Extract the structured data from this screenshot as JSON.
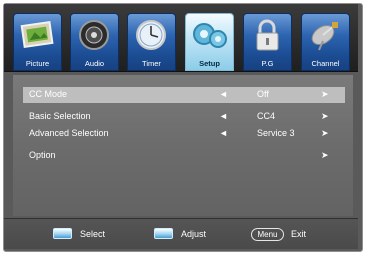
{
  "tabs": [
    {
      "label": "Picture",
      "icon": "picture-frame-icon",
      "active": false
    },
    {
      "label": "Audio",
      "icon": "speaker-icon",
      "active": false
    },
    {
      "label": "Timer",
      "icon": "clock-icon",
      "active": false
    },
    {
      "label": "Setup",
      "icon": "gears-icon",
      "active": true
    },
    {
      "label": "P.G",
      "icon": "padlock-icon",
      "active": false
    },
    {
      "label": "Channel",
      "icon": "satellite-dish-icon",
      "active": false
    }
  ],
  "menu": [
    {
      "label": "CC  Mode",
      "value": "Off",
      "left_arrow": "◄",
      "right_arrow": "➤",
      "selected": true
    },
    {
      "label": "Basic Selection",
      "value": "CC4",
      "left_arrow": "◄",
      "right_arrow": "➤",
      "selected": false
    },
    {
      "label": "Advanced Selection",
      "value": "Service 3",
      "left_arrow": "◄",
      "right_arrow": "➤",
      "selected": false
    },
    {
      "label": "Option",
      "value": "",
      "left_arrow": "",
      "right_arrow": "➤",
      "selected": false
    }
  ],
  "footer": {
    "select_label": "Select",
    "adjust_label": "Adjust",
    "menu_key": "Menu",
    "exit_label": "Exit"
  },
  "colors": {
    "tab_blue": "#2d64b0",
    "tab_active": "#bfe4f6",
    "panel": "#6c6c6c",
    "highlight": "#bebebe"
  }
}
